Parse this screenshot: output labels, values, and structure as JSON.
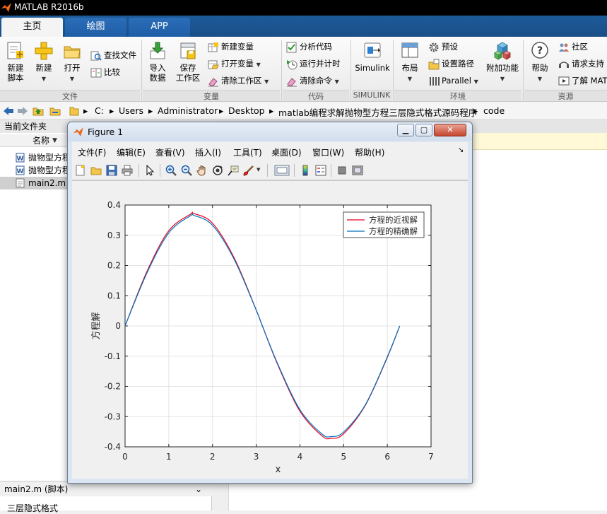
{
  "app": {
    "title": "MATLAB R2016b"
  },
  "tabs": [
    {
      "label": "主页",
      "active": true
    },
    {
      "label": "绘图",
      "active": false
    },
    {
      "label": "APP",
      "active": false
    }
  ],
  "ribbon": {
    "file": {
      "new_script": "新建\n脚本",
      "new_script_l1": "新建",
      "new_script_l2": "脚本",
      "new": "新建",
      "open": "打开",
      "find_files": "查找文件",
      "compare": "比较",
      "group": "文件"
    },
    "variable": {
      "import_l1": "导入",
      "import_l2": "数据",
      "save_l1": "保存",
      "save_l2": "工作区",
      "new_var": "新建变量",
      "open_var": "打开变量",
      "clear_ws": "清除工作区",
      "group": "变量"
    },
    "code": {
      "analyze": "分析代码",
      "run_time": "运行并计时",
      "clear_cmd": "清除命令",
      "group": "代码"
    },
    "simulink": {
      "label": "Simulink",
      "group": "SIMULINK"
    },
    "env": {
      "layout": "布局",
      "prefs": "预设",
      "set_path": "设置路径",
      "parallel": "Parallel",
      "group": "环境"
    },
    "addons": {
      "label": "附加功能"
    },
    "resources": {
      "help": "帮助",
      "community": "社区",
      "support": "请求支持",
      "learn": "了解 MAT",
      "group": "资源"
    }
  },
  "address": {
    "segments": [
      "C:",
      "Users",
      "Administrator",
      "Desktop",
      "matlab编程求解抛物型方程三层隐式格式源码程序",
      "code"
    ]
  },
  "current_folder": {
    "title": "当前文件夹",
    "col_name": "名称",
    "files": [
      {
        "name": "抛物型方程",
        "type": "doc",
        "selected": false
      },
      {
        "name": "抛物型方程",
        "type": "doc",
        "selected": false
      },
      {
        "name": "main2.m",
        "type": "m",
        "selected": true
      }
    ],
    "details_label": "main2.m  (脚本)",
    "details_text": "三层隐式格式"
  },
  "figure": {
    "title": "Figure 1",
    "menu": [
      "文件(F)",
      "编辑(E)",
      "查看(V)",
      "插入(I)",
      "工具(T)",
      "桌面(D)",
      "窗口(W)",
      "帮助(H)"
    ],
    "toolbar_icons": [
      "new-figure-icon",
      "open-file-icon",
      "save-icon",
      "print-icon",
      "pointer-icon",
      "zoom-in-icon",
      "zoom-out-icon",
      "pan-icon",
      "rotate-icon",
      "data-cursor-icon",
      "brush-icon",
      "link-plot-icon",
      "colorbar-icon",
      "legend-icon",
      "hide-plot-tools-icon",
      "show-plot-tools-icon"
    ]
  },
  "chart_data": {
    "type": "line",
    "xlabel": "x",
    "ylabel": "方程解",
    "xlim": [
      0,
      7
    ],
    "ylim": [
      -0.4,
      0.4
    ],
    "xticks": [
      0,
      1,
      2,
      3,
      4,
      5,
      6,
      7
    ],
    "yticks": [
      -0.4,
      -0.3,
      -0.2,
      -0.1,
      0,
      0.1,
      0.2,
      0.3,
      0.4
    ],
    "grid": true,
    "legend_position": "top-right",
    "series": [
      {
        "name": "方程的近视解",
        "color": "#e8001c",
        "x": [
          0,
          0.5,
          1.0,
          1.5,
          1.5708,
          2.0,
          2.5,
          3.0,
          3.1416,
          3.5,
          4.0,
          4.5,
          4.7124,
          5.0,
          5.5,
          6.0,
          6.2832
        ],
        "y": [
          0,
          0.18,
          0.315,
          0.37,
          0.372,
          0.34,
          0.224,
          0.053,
          0,
          -0.131,
          -0.282,
          -0.363,
          -0.372,
          -0.357,
          -0.262,
          -0.104,
          0
        ]
      },
      {
        "name": "方程的精确解",
        "color": "#0072bd",
        "x": [
          0,
          0.5,
          1.0,
          1.5,
          1.5708,
          2.0,
          2.5,
          3.0,
          3.1416,
          3.5,
          4.0,
          4.5,
          4.7124,
          5.0,
          5.5,
          6.0,
          6.2832
        ],
        "y": [
          0,
          0.175,
          0.308,
          0.365,
          0.366,
          0.333,
          0.219,
          0.052,
          0,
          -0.128,
          -0.277,
          -0.357,
          -0.366,
          -0.351,
          -0.26,
          -0.102,
          0
        ]
      }
    ]
  },
  "colors": {
    "tabstrip": "#1a4f88",
    "window_border": "#6d7f97",
    "close_button": "#c5452e"
  }
}
